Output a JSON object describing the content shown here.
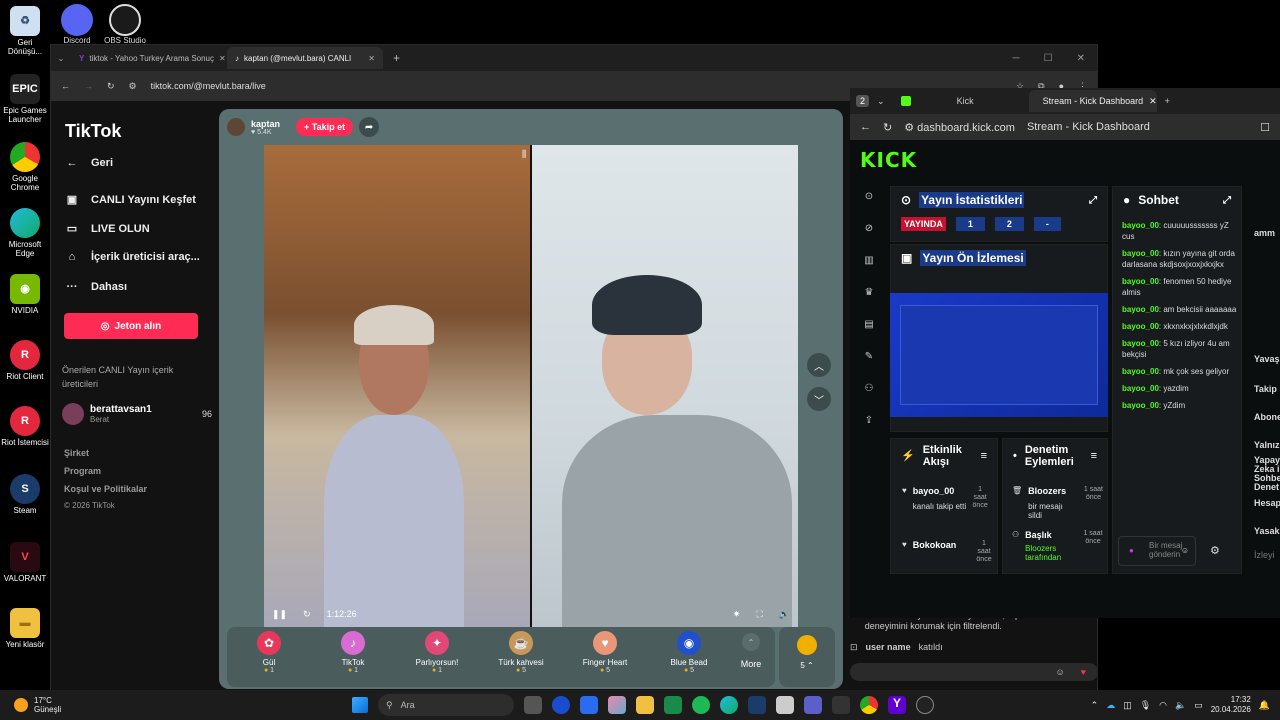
{
  "desktop": {
    "icons": [
      {
        "label": "Geri Dönüşü...",
        "name": "recycle-bin-icon"
      },
      {
        "label": "Epic Games Launcher",
        "name": "epic-games-icon"
      },
      {
        "label": "Google Chrome",
        "name": "chrome-icon"
      },
      {
        "label": "Microsoft Edge",
        "name": "edge-icon"
      },
      {
        "label": "NVIDIA",
        "name": "nvidia-icon"
      },
      {
        "label": "Riot Client",
        "name": "riot-client-icon"
      },
      {
        "label": "Riot İstemcisi",
        "name": "riot-istemcisi-icon"
      },
      {
        "label": "Steam",
        "name": "steam-icon"
      },
      {
        "label": "VALORANT",
        "name": "valorant-icon"
      },
      {
        "label": "Yeni klasör",
        "name": "folder-icon"
      }
    ],
    "top_icons": [
      {
        "label": "Discord",
        "name": "discord-icon"
      },
      {
        "label": "OBS Studio",
        "name": "obs-icon"
      }
    ]
  },
  "browser1": {
    "tabs": [
      {
        "label": "tiktok - Yahoo Turkey Arama Sonuç"
      },
      {
        "label": "kaptan (@mevlut.bara) CANLI"
      }
    ],
    "url": "tiktok.com/@mevlut.bara/live"
  },
  "tiktok": {
    "logo": "TikTok",
    "nav": {
      "back": "Geri",
      "explore": "CANLI Yayını Keşfet",
      "go_live": "LIVE OLUN",
      "creator_tools": "İçerik üreticisi araç...",
      "more": "Dahası"
    },
    "jeton_button": "Jeton alın",
    "suggested_title": "Önerilen CANLI Yayın içerik üreticileri",
    "suggested_user": {
      "name": "berattavsan1",
      "sub": "Berat",
      "count": "96"
    },
    "footer": {
      "company": "Şirket",
      "program": "Program",
      "terms": "Koşul ve Politikalar",
      "copyright": "© 2026 TikTok"
    }
  },
  "live": {
    "host_name": "kaptan",
    "host_likes": "5.4K",
    "follow_label": "+ Takip et",
    "timer": "1:12:26",
    "gifts": [
      {
        "name": "Gül",
        "price": "1",
        "color": "#e8385a",
        "glyph": "✿"
      },
      {
        "name": "TikTok",
        "price": "1",
        "color": "#d86cd0",
        "glyph": "♪"
      },
      {
        "name": "Parlıyorsun!",
        "price": "1",
        "color": "#e04878",
        "glyph": "✦"
      },
      {
        "name": "Türk kahvesi",
        "price": "5",
        "color": "#c89858",
        "glyph": "☕"
      },
      {
        "name": "Finger Heart",
        "price": "5",
        "color": "#e89878",
        "glyph": "♥"
      },
      {
        "name": "Blue Bead",
        "price": "5",
        "color": "#2050d0",
        "glyph": "◉"
      }
    ],
    "more_label": "More",
    "coin_count": "5 ⌃",
    "chat_notice": "Bu CANLI Yayındaki bazı yorumlar, topluluk deneyimini korumak için filtrelendi.",
    "join_user": "user name",
    "join_text": "katıldı"
  },
  "browser2": {
    "tab_count": "2",
    "tabs": [
      {
        "label": "Kick"
      },
      {
        "label": "Stream - Kick Dashboard"
      }
    ],
    "url": "dashboard.kick.com",
    "page_title": "Stream - Kick Dashboard"
  },
  "kick": {
    "logo": "KICK",
    "stats_title": "Yayın İstatistikleri",
    "live_badge": "YAYINDA",
    "stat_values": [
      "1",
      "2",
      "-"
    ],
    "preview_title": "Yayın Ön İzlemesi",
    "chat_title": "Sohbet",
    "chat_messages": [
      {
        "user": "bayoo_00",
        "text": "cuuuuusssssss yZ cus"
      },
      {
        "user": "bayoo_00",
        "text": "kızın yayına git orda darlasana skdjsoxjxoxjxkxjkx"
      },
      {
        "user": "bayoo_00",
        "text": "fenomen 50 hediye almis"
      },
      {
        "user": "bayoo_00",
        "text": "am bekcisii aaaaaaa"
      },
      {
        "user": "bayoo_00",
        "text": "xkxnxkxjxlxkdlxjdk"
      },
      {
        "user": "bayoo_00",
        "text": "5 kızı izliyor 4u am bekçisi"
      },
      {
        "user": "bayoo_00",
        "text": "mk çok ses geliyor"
      },
      {
        "user": "bayoo_00",
        "text": "yazdim"
      },
      {
        "user": "bayoo_00",
        "text": "yZdim"
      }
    ],
    "activity_title": "Etkinlik Akışı",
    "activity": [
      {
        "name": "bayoo_00",
        "sub": "kanalı takip etti",
        "time": "1 saat önce"
      },
      {
        "name": "Bokokoan",
        "sub": "",
        "time": "1 saat önce"
      }
    ],
    "mod_title": "Denetim Eylemleri",
    "mod_actions": [
      {
        "name": "Bloozers",
        "sub": "bir mesajı sildi",
        "time": "1 saat önce"
      },
      {
        "name": "Başlık",
        "sub": "Bloozers tarafından",
        "time": "1 saat önce"
      }
    ],
    "message_placeholder": "Bir mesaj gönderin",
    "side_labels": [
      "amm",
      "Yavaş",
      "Takip",
      "Abone",
      "Yalnız",
      "Yapay Zeka i Sohbe Denet",
      "Hesap",
      "Yasak",
      "İzleyi"
    ]
  },
  "taskbar": {
    "temp": "17°C",
    "weather": "Güneşli",
    "search": "Ara",
    "time": "17:32",
    "date": "20.04.2026"
  }
}
